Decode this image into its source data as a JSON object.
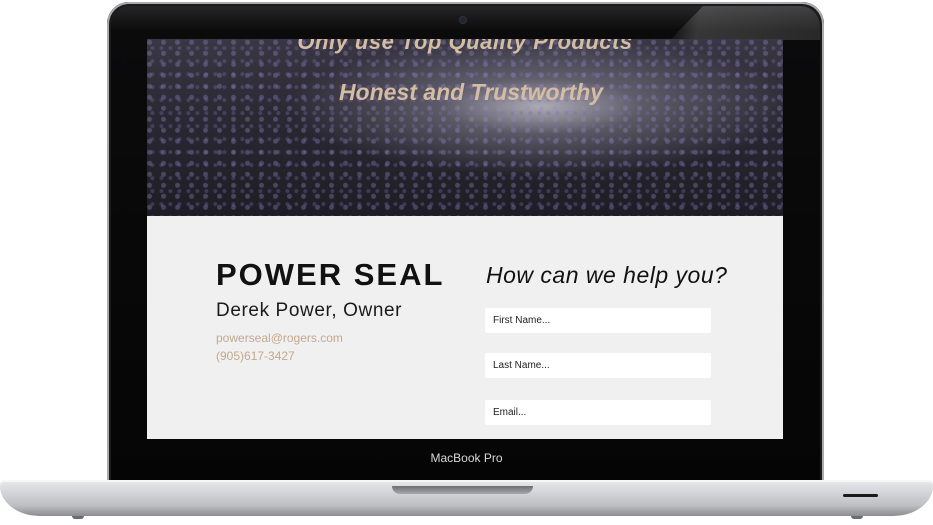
{
  "hero": {
    "line1": "Only use Top Quality Products",
    "line2": "Honest and Trustworthy"
  },
  "business": {
    "name": "POWER SEAL",
    "owner": "Derek Power, Owner",
    "email": "powerseal@rogers.com",
    "phone": "(905)617-3427"
  },
  "contact_form": {
    "title": "How can we help you?",
    "first_name_placeholder": "First Name...",
    "last_name_placeholder": "Last Name...",
    "email_placeholder": "Email..."
  },
  "device": {
    "model_label": "MacBook Pro"
  },
  "colors": {
    "accent": "#c3a98b",
    "hero_text": "#d3bea3",
    "page_bg": "#f0f0f0"
  }
}
